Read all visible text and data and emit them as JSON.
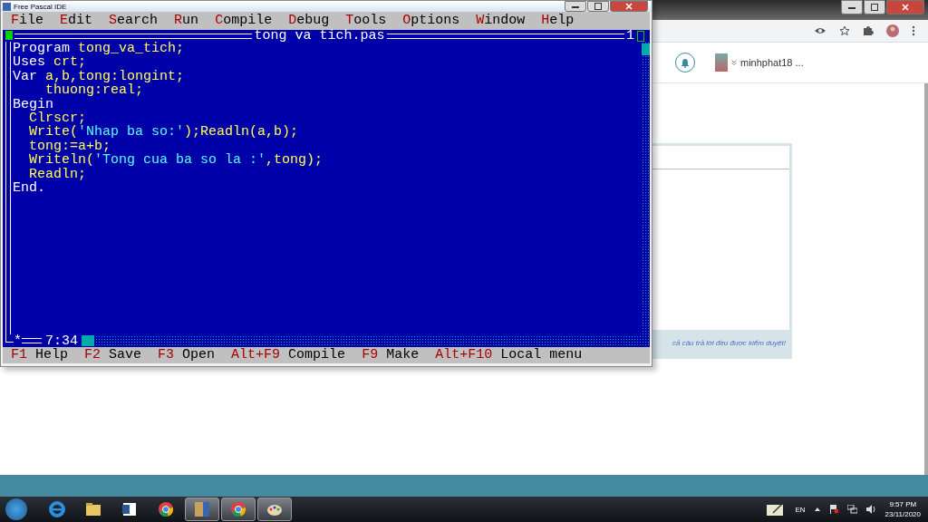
{
  "ide": {
    "title": "Free Pascal IDE",
    "menu": [
      {
        "hotkey": "F",
        "rest": "ile"
      },
      {
        "hotkey": "E",
        "rest": "dit"
      },
      {
        "hotkey": "S",
        "rest": "earch"
      },
      {
        "hotkey": "R",
        "rest": "un"
      },
      {
        "hotkey": "C",
        "rest": "ompile"
      },
      {
        "hotkey": "D",
        "rest": "ebug"
      },
      {
        "hotkey": "T",
        "rest": "ools"
      },
      {
        "hotkey": "O",
        "rest": "ptions"
      },
      {
        "hotkey": "W",
        "rest": "indow"
      },
      {
        "hotkey": "H",
        "rest": "elp"
      }
    ],
    "editor": {
      "title": "tong va tich.pas",
      "number": "1",
      "modified_mark": "*",
      "cursor": "7:34",
      "lines": [
        [
          {
            "kind": "keyword",
            "text": "Program "
          },
          {
            "kind": "ident",
            "text": "tong_va_tich;"
          }
        ],
        [
          {
            "kind": "keyword",
            "text": "Uses "
          },
          {
            "kind": "ident",
            "text": "crt;"
          }
        ],
        [
          {
            "kind": "keyword",
            "text": "Var "
          },
          {
            "kind": "ident",
            "text": "a,b,tong:longint;"
          }
        ],
        [
          {
            "kind": "ident",
            "text": "    thuong:real;"
          }
        ],
        [
          {
            "kind": "keyword",
            "text": "Begin"
          }
        ],
        [
          {
            "kind": "ident",
            "text": "  Clrscr;"
          }
        ],
        [
          {
            "kind": "ident",
            "text": "  Write("
          },
          {
            "kind": "string",
            "text": "'Nhap ba so:'"
          },
          {
            "kind": "ident",
            "text": ");Readln(a,b);"
          }
        ],
        [
          {
            "kind": "ident",
            "text": "  tong:=a+b;"
          }
        ],
        [
          {
            "kind": "ident",
            "text": "  Writeln("
          },
          {
            "kind": "string",
            "text": "'Tong cua ba so la :'"
          },
          {
            "kind": "ident",
            "text": ",tong);"
          }
        ],
        [
          {
            "kind": "ident",
            "text": "  Readln;"
          }
        ],
        [
          {
            "kind": "keyword",
            "text": "End."
          }
        ]
      ]
    },
    "status_bar": [
      {
        "key": "F1",
        "label": "Help"
      },
      {
        "key": "F2",
        "label": "Save"
      },
      {
        "key": "F3",
        "label": "Open"
      },
      {
        "key": "Alt+F9",
        "label": "Compile"
      },
      {
        "key": "F9",
        "label": "Make"
      },
      {
        "key": "Alt+F10",
        "label": "Local menu"
      }
    ]
  },
  "browser": {
    "user": "minhphat18 ...",
    "notice": "cả câu trả lời đều được kiểm duyệt!"
  },
  "taskbar": {
    "apps": [
      {
        "kind": "ie",
        "open": false
      },
      {
        "kind": "folder",
        "open": false
      },
      {
        "kind": "word",
        "open": false
      },
      {
        "kind": "chrome",
        "open": false
      },
      {
        "kind": "pascal",
        "open": true
      },
      {
        "kind": "chrome",
        "open": true
      },
      {
        "kind": "paint",
        "open": true
      }
    ],
    "language": "EN",
    "time": "9:57 PM",
    "date": "23/11/2020"
  }
}
